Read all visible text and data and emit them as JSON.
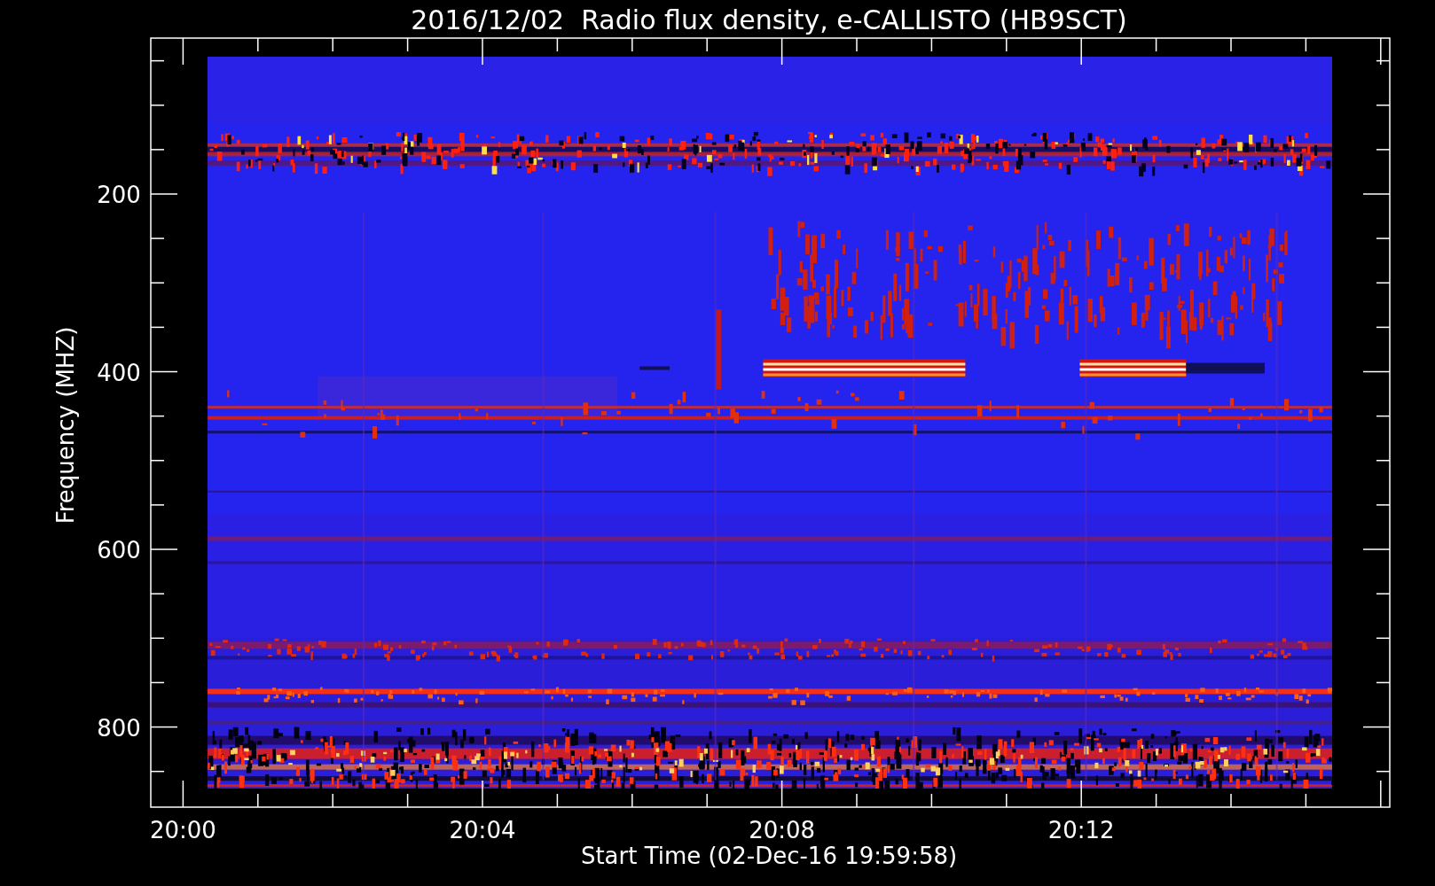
{
  "title": "2016/12/02  Radio flux density, e-CALLISTO (HB9SCT)",
  "y_axis": {
    "label": "Frequency (MHZ)",
    "tick_labels": [
      "200",
      "400",
      "600",
      "800"
    ]
  },
  "x_axis": {
    "label": "Start Time (02-Dec-16 19:59:58)",
    "tick_labels": [
      "20:00",
      "20:04",
      "20:08",
      "20:12"
    ]
  }
}
